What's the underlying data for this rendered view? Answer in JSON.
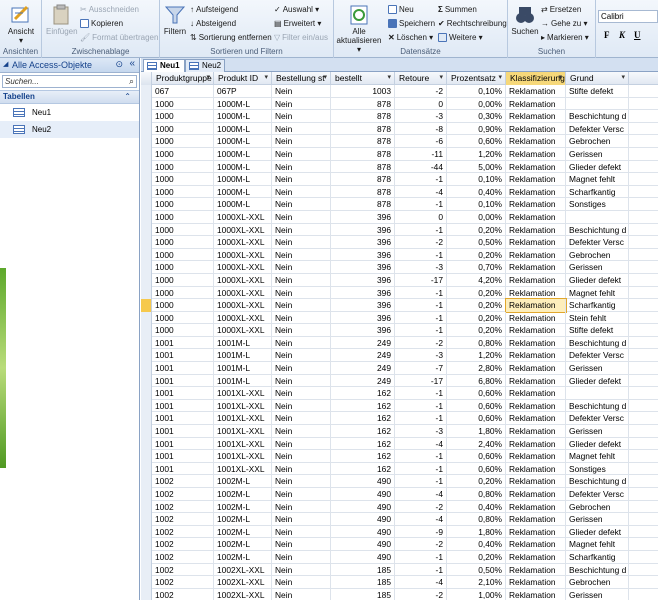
{
  "ribbon": {
    "groups": {
      "ansichten": "Ansichten",
      "zwischenablage": "Zwischenablage",
      "sortieren": "Sortieren und Filtern",
      "datensaetze": "Datensätze",
      "suchen": "Suchen"
    },
    "ansicht": "Ansicht",
    "einfuegen": "Einfügen",
    "ausschneiden": "Ausschneiden",
    "kopieren": "Kopieren",
    "format": "Format übertragen",
    "filtern": "Filtern",
    "aufsteigend": "Aufsteigend",
    "absteigend": "Absteigend",
    "sortierung": "Sortierung entfernen",
    "auswahl": "Auswahl ▾",
    "erweitert": "Erweitert ▾",
    "filter_ein": "Filter ein/aus",
    "alle_akt_1": "Alle",
    "alle_akt_2": "aktualisieren ▾",
    "neu": "Neu",
    "speichern": "Speichern",
    "loeschen": "Löschen ▾",
    "summen": "Summen",
    "rechtschreibung": "Rechtschreibung",
    "weitere": "Weitere ▾",
    "suchen": "Suchen",
    "ersetzen": "Ersetzen",
    "gehe_zu": "Gehe zu ▾",
    "markieren": "Markieren ▾",
    "font": "Calibri",
    "bold": "F",
    "italic": "K",
    "underline": "U"
  },
  "nav": {
    "title": "Alle Access-Objekte",
    "search_placeholder": "Suchen...",
    "category": "Tabellen",
    "items": [
      "Neu1",
      "Neu2"
    ]
  },
  "tabs": [
    "Neu1",
    "Neu2"
  ],
  "columns": [
    "Produktgruppe",
    "Produkt ID",
    "Bestellung st",
    "bestellt",
    "Retoure",
    "Prozentsatz",
    "Klassifizierung",
    "Grund"
  ],
  "rows": [
    [
      "067",
      "067P",
      "Nein",
      "1003",
      "-2",
      "0,10%",
      "Reklamation",
      "Stifte defekt"
    ],
    [
      "1000",
      "1000M-L",
      "Nein",
      "878",
      "0",
      "0,00%",
      "Reklamation",
      ""
    ],
    [
      "1000",
      "1000M-L",
      "Nein",
      "878",
      "-3",
      "0,30%",
      "Reklamation",
      "Beschichtung d"
    ],
    [
      "1000",
      "1000M-L",
      "Nein",
      "878",
      "-8",
      "0,90%",
      "Reklamation",
      "Defekter Versc"
    ],
    [
      "1000",
      "1000M-L",
      "Nein",
      "878",
      "-6",
      "0,60%",
      "Reklamation",
      "Gebrochen"
    ],
    [
      "1000",
      "1000M-L",
      "Nein",
      "878",
      "-11",
      "1,20%",
      "Reklamation",
      "Gerissen"
    ],
    [
      "1000",
      "1000M-L",
      "Nein",
      "878",
      "-44",
      "5,00%",
      "Reklamation",
      "Glieder defekt"
    ],
    [
      "1000",
      "1000M-L",
      "Nein",
      "878",
      "-1",
      "0,10%",
      "Reklamation",
      "Magnet fehlt"
    ],
    [
      "1000",
      "1000M-L",
      "Nein",
      "878",
      "-4",
      "0,40%",
      "Reklamation",
      "Scharfkantig"
    ],
    [
      "1000",
      "1000M-L",
      "Nein",
      "878",
      "-1",
      "0,10%",
      "Reklamation",
      "Sonstiges"
    ],
    [
      "1000",
      "1000XL-XXL",
      "Nein",
      "396",
      "0",
      "0,00%",
      "Reklamation",
      ""
    ],
    [
      "1000",
      "1000XL-XXL",
      "Nein",
      "396",
      "-1",
      "0,20%",
      "Reklamation",
      "Beschichtung d"
    ],
    [
      "1000",
      "1000XL-XXL",
      "Nein",
      "396",
      "-2",
      "0,50%",
      "Reklamation",
      "Defekter Versc"
    ],
    [
      "1000",
      "1000XL-XXL",
      "Nein",
      "396",
      "-1",
      "0,20%",
      "Reklamation",
      "Gebrochen"
    ],
    [
      "1000",
      "1000XL-XXL",
      "Nein",
      "396",
      "-3",
      "0,70%",
      "Reklamation",
      "Gerissen"
    ],
    [
      "1000",
      "1000XL-XXL",
      "Nein",
      "396",
      "-17",
      "4,20%",
      "Reklamation",
      "Glieder defekt"
    ],
    [
      "1000",
      "1000XL-XXL",
      "Nein",
      "396",
      "-1",
      "0,20%",
      "Reklamation",
      "Magnet fehlt"
    ],
    [
      "1000",
      "1000XL-XXL",
      "Nein",
      "396",
      "-1",
      "0,20%",
      "Reklamation",
      "Scharfkantig"
    ],
    [
      "1000",
      "1000XL-XXL",
      "Nein",
      "396",
      "-1",
      "0,20%",
      "Reklamation",
      "Stein fehlt"
    ],
    [
      "1000",
      "1000XL-XXL",
      "Nein",
      "396",
      "-1",
      "0,20%",
      "Reklamation",
      "Stifte defekt"
    ],
    [
      "1001",
      "1001M-L",
      "Nein",
      "249",
      "-2",
      "0,80%",
      "Reklamation",
      "Beschichtung d"
    ],
    [
      "1001",
      "1001M-L",
      "Nein",
      "249",
      "-3",
      "1,20%",
      "Reklamation",
      "Defekter Versc"
    ],
    [
      "1001",
      "1001M-L",
      "Nein",
      "249",
      "-7",
      "2,80%",
      "Reklamation",
      "Gerissen"
    ],
    [
      "1001",
      "1001M-L",
      "Nein",
      "249",
      "-17",
      "6,80%",
      "Reklamation",
      "Glieder defekt"
    ],
    [
      "1001",
      "1001XL-XXL",
      "Nein",
      "162",
      "-1",
      "0,60%",
      "Reklamation",
      ""
    ],
    [
      "1001",
      "1001XL-XXL",
      "Nein",
      "162",
      "-1",
      "0,60%",
      "Reklamation",
      "Beschichtung d"
    ],
    [
      "1001",
      "1001XL-XXL",
      "Nein",
      "162",
      "-1",
      "0,60%",
      "Reklamation",
      "Defekter Versc"
    ],
    [
      "1001",
      "1001XL-XXL",
      "Nein",
      "162",
      "-3",
      "1,80%",
      "Reklamation",
      "Gerissen"
    ],
    [
      "1001",
      "1001XL-XXL",
      "Nein",
      "162",
      "-4",
      "2,40%",
      "Reklamation",
      "Glieder defekt"
    ],
    [
      "1001",
      "1001XL-XXL",
      "Nein",
      "162",
      "-1",
      "0,60%",
      "Reklamation",
      "Magnet fehlt"
    ],
    [
      "1001",
      "1001XL-XXL",
      "Nein",
      "162",
      "-1",
      "0,60%",
      "Reklamation",
      "Sonstiges"
    ],
    [
      "1002",
      "1002M-L",
      "Nein",
      "490",
      "-1",
      "0,20%",
      "Reklamation",
      "Beschichtung d"
    ],
    [
      "1002",
      "1002M-L",
      "Nein",
      "490",
      "-4",
      "0,80%",
      "Reklamation",
      "Defekter Versc"
    ],
    [
      "1002",
      "1002M-L",
      "Nein",
      "490",
      "-2",
      "0,40%",
      "Reklamation",
      "Gebrochen"
    ],
    [
      "1002",
      "1002M-L",
      "Nein",
      "490",
      "-4",
      "0,80%",
      "Reklamation",
      "Gerissen"
    ],
    [
      "1002",
      "1002M-L",
      "Nein",
      "490",
      "-9",
      "1,80%",
      "Reklamation",
      "Glieder defekt"
    ],
    [
      "1002",
      "1002M-L",
      "Nein",
      "490",
      "-2",
      "0,40%",
      "Reklamation",
      "Magnet fehlt"
    ],
    [
      "1002",
      "1002M-L",
      "Nein",
      "490",
      "-1",
      "0,20%",
      "Reklamation",
      "Scharfkantig"
    ],
    [
      "1002",
      "1002XL-XXL",
      "Nein",
      "185",
      "-1",
      "0,50%",
      "Reklamation",
      "Beschichtung d"
    ],
    [
      "1002",
      "1002XL-XXL",
      "Nein",
      "185",
      "-4",
      "2,10%",
      "Reklamation",
      "Gebrochen"
    ],
    [
      "1002",
      "1002XL-XXL",
      "Nein",
      "185",
      "-2",
      "1,00%",
      "Reklamation",
      "Gerissen"
    ]
  ],
  "current_row": 17,
  "colors": {
    "accent": "#f6d87a",
    "nav_title": "#15428b"
  }
}
